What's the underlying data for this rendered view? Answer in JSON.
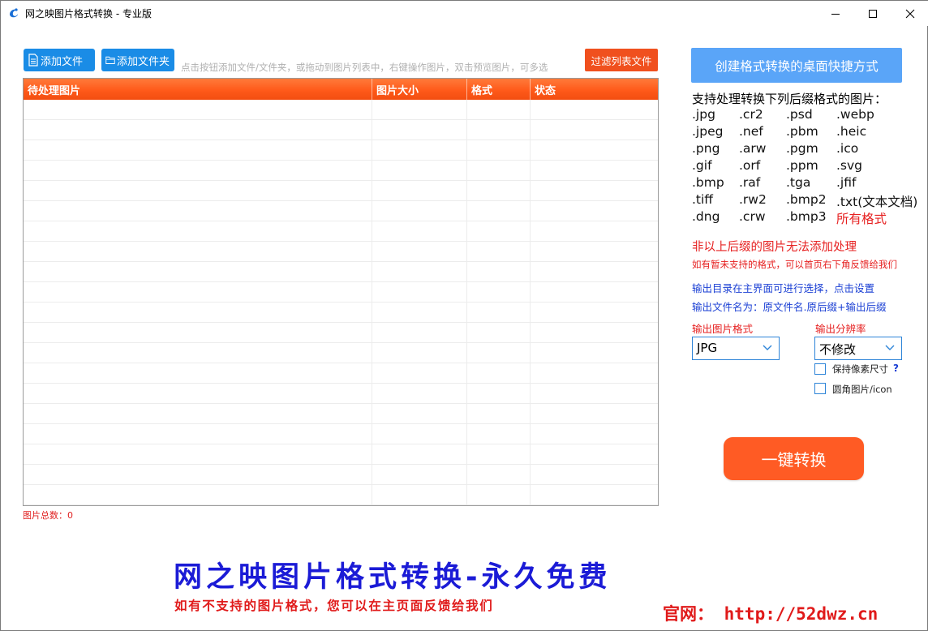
{
  "window": {
    "title": "网之映图片格式转换 - 专业版"
  },
  "toolbar": {
    "add_file_label": "添加文件",
    "add_folder_label": "添加文件夹",
    "hint": "点击按钮添加文件/文件夹，或拖动到图片列表中，右键操作图片，双击预览图片，可多选",
    "filter_label": "过滤列表文件"
  },
  "table": {
    "columns": [
      "待处理图片",
      "图片大小",
      "格式",
      "状态"
    ],
    "empty_rows": 20
  },
  "status": {
    "total_label": "图片总数：0"
  },
  "panel": {
    "shortcut_button": "创建格式转换的桌面快捷方式",
    "support_title": "支持处理转换下列后缀格式的图片：",
    "formats": [
      [
        ".jpg",
        ".cr2",
        ".psd",
        ".webp"
      ],
      [
        ".jpeg",
        ".nef",
        ".pbm",
        ".heic"
      ],
      [
        ".png",
        ".arw",
        ".pgm",
        ".ico"
      ],
      [
        ".gif",
        ".orf",
        ".ppm",
        ".svg"
      ],
      [
        ".bmp",
        ".raf",
        ".tga",
        ".jfif"
      ],
      [
        ".tiff",
        ".rw2",
        ".bmp2",
        ".txt(文本文档)"
      ],
      [
        ".dng",
        ".crw",
        ".bmp3",
        "所有格式"
      ]
    ],
    "warning_main": "非以上后缀的图片无法添加处理",
    "warning_sub": "如有暂未支持的格式，可以首页右下角反馈给我们",
    "info_output_dir": "输出目录在主界面可进行选择，点击设置",
    "info_output_name": "输出文件名为：原文件名.原后缀+输出后缀",
    "output_format_label": "输出图片格式",
    "output_format_value": "JPG",
    "output_resolution_label": "输出分辨率",
    "output_resolution_value": "不修改",
    "keep_pixel_size_label": "保持像素尺寸",
    "keep_pixel_size_checked": false,
    "round_corner_label": "圆角图片/icon",
    "round_corner_checked": false,
    "help_mark": "?",
    "convert_button": "一键转换"
  },
  "banner": {
    "title": "网之映图片格式转换-永久免费",
    "subtitle": "如有不支持的图片格式，您可以在主页面反馈给我们",
    "url": "官网： http://52dwz.cn"
  },
  "colors": {
    "accent_blue": "#1a8ce6",
    "accent_orange": "#ff5b24",
    "header_orange": "#ff5a1a",
    "text_red": "#e62020",
    "text_blue": "#1a3fd4"
  }
}
